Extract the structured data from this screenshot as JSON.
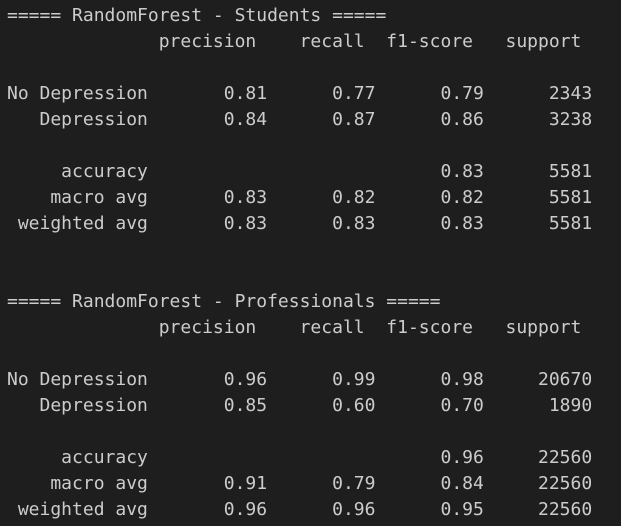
{
  "terminal": {
    "lines": [
      "===== RandomForest - Students =====",
      "              precision    recall  f1-score   support",
      "",
      "No Depression       0.81      0.77      0.79      2343",
      "   Depression       0.84      0.87      0.86      3238",
      "",
      "     accuracy                           0.83      5581",
      "    macro avg       0.83      0.82      0.82      5581",
      " weighted avg       0.83      0.83      0.83      5581",
      "",
      "",
      "===== RandomForest - Professionals =====",
      "              precision    recall  f1-score   support",
      "",
      "No Depression       0.96      0.99      0.98     20670",
      "   Depression       0.85      0.60      0.70      1890",
      "",
      "     accuracy                           0.96     22560",
      "    macro avg       0.91      0.79      0.84     22560",
      " weighted avg       0.96      0.96      0.95     22560"
    ]
  }
}
